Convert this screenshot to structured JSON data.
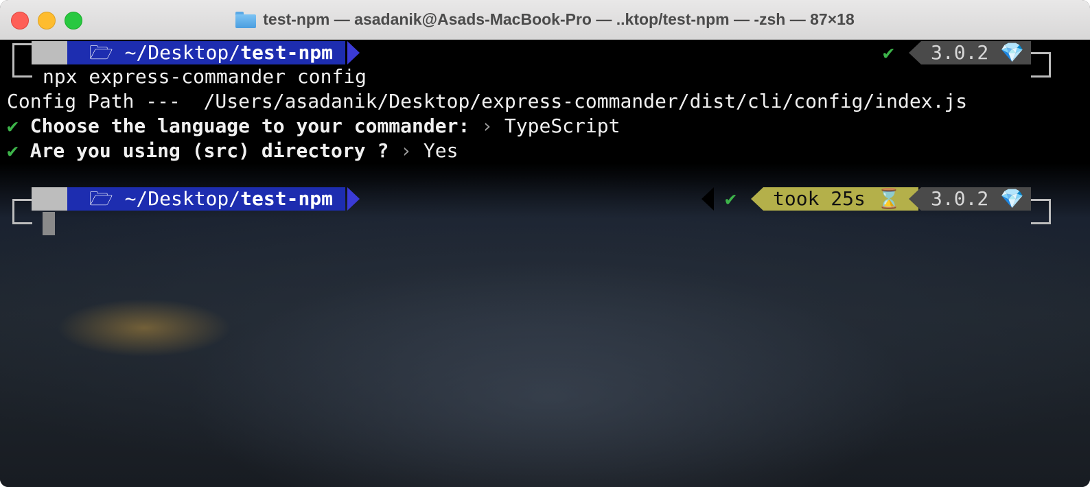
{
  "window": {
    "title": "test-npm — asadanik@Asads-MacBook-Pro — ..ktop/test-npm — -zsh — 87×18",
    "folder_icon": "folder-icon"
  },
  "prompt1": {
    "apple": "",
    "dir_prefix": "🗁 ~/Desktop/",
    "dir_name": "test-npm",
    "status": "✔",
    "version": "3.0.2 💎"
  },
  "command": "npx express-commander config",
  "output": {
    "config_path": "Config Path ---  /Users/asadanik/Desktop/express-commander/dist/cli/config/index.js",
    "q1_check": "✔",
    "q1_label": "Choose the language to your commander:",
    "q1_sep": " › ",
    "q1_answer": "TypeScript",
    "q2_check": "✔",
    "q2_label": "Are you using (src) directory ?",
    "q2_sep": " › ",
    "q2_answer": "Yes"
  },
  "prompt2": {
    "apple": "",
    "dir_prefix": "🗁 ~/Desktop/",
    "dir_name": "test-npm",
    "status": "✔",
    "took": "took 25s ⌛",
    "version": "3.0.2 💎"
  },
  "colors": {
    "dir_segment": "#1d2db0",
    "arrow_accent": "#3b3bd6",
    "success_green": "#3db44a",
    "took_segment": "#b4b04a",
    "version_segment": "#4a4a4a"
  }
}
